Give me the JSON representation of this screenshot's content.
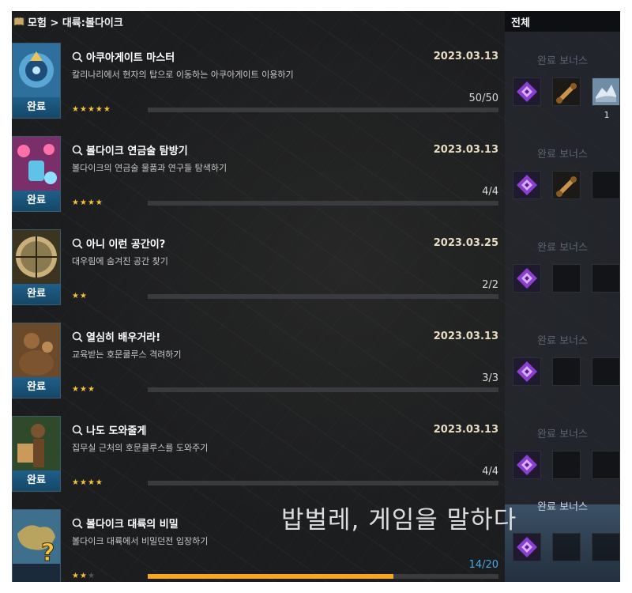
{
  "breadcrumb": "모험 > 대륙:볼다이크",
  "filter": "전체",
  "bonus_label": "완료 보너스",
  "watermark": "밥벌레, 게임을 말하다",
  "accent": "#f6a623",
  "quests": [
    {
      "title": "아쿠아게이트 마스터",
      "desc": "칼리나리에서 현자의 탑으로 이동하는 아쿠아게이트 이용하기",
      "date": "2023.03.13",
      "progress": "50/50",
      "ratio": 0,
      "stars": 5,
      "max_stars": 5,
      "status": "완료",
      "thumb": "aquagate-icon",
      "rewards": [
        "gem-icon",
        "scroll-icon",
        "map-icon"
      ],
      "reward_count": "1"
    },
    {
      "title": "볼다이크 연금술 탐방기",
      "desc": "볼다이크의 연금술 물품과 연구들 탐색하기",
      "date": "2023.03.13",
      "progress": "4/4",
      "ratio": 0,
      "stars": 4,
      "max_stars": 4,
      "status": "완료",
      "thumb": "alchemy-icon",
      "rewards": [
        "gem-icon",
        "scroll-icon",
        "empty"
      ],
      "reward_count": ""
    },
    {
      "title": "아니 이런 공간이?",
      "desc": "대우림에 숨겨진 공간 찾기",
      "date": "2023.03.25",
      "progress": "2/2",
      "ratio": 0,
      "stars": 2,
      "max_stars": 2,
      "status": "완료",
      "thumb": "hidden-space-icon",
      "rewards": [
        "gem-icon",
        "empty",
        "empty"
      ],
      "reward_count": ""
    },
    {
      "title": "열심히 배우거라!",
      "desc": "교육받는 호문쿨루스 격려하기",
      "date": "2023.03.13",
      "progress": "3/3",
      "ratio": 0,
      "stars": 3,
      "max_stars": 3,
      "status": "완료",
      "thumb": "homunculus-icon",
      "rewards": [
        "gem-icon",
        "empty",
        "empty"
      ],
      "reward_count": ""
    },
    {
      "title": "나도 도와줄게",
      "desc": "집무실 근처의 호문쿨루스를 도와주기",
      "date": "2023.03.13",
      "progress": "4/4",
      "ratio": 0,
      "stars": 4,
      "max_stars": 4,
      "status": "완료",
      "thumb": "helper-icon",
      "rewards": [
        "gem-icon",
        "empty",
        "empty"
      ],
      "reward_count": ""
    },
    {
      "title": "볼다이크 대륙의 비밀",
      "desc": "볼다이크 대륙에서 비밀던전 입장하기",
      "date": "",
      "progress": "14/20",
      "ratio": 0.7,
      "stars": 2,
      "max_stars": 3,
      "status": "",
      "thumb": "secret-map-icon",
      "rewards": [
        "gem-icon",
        "empty",
        "empty"
      ],
      "reward_count": ""
    }
  ]
}
